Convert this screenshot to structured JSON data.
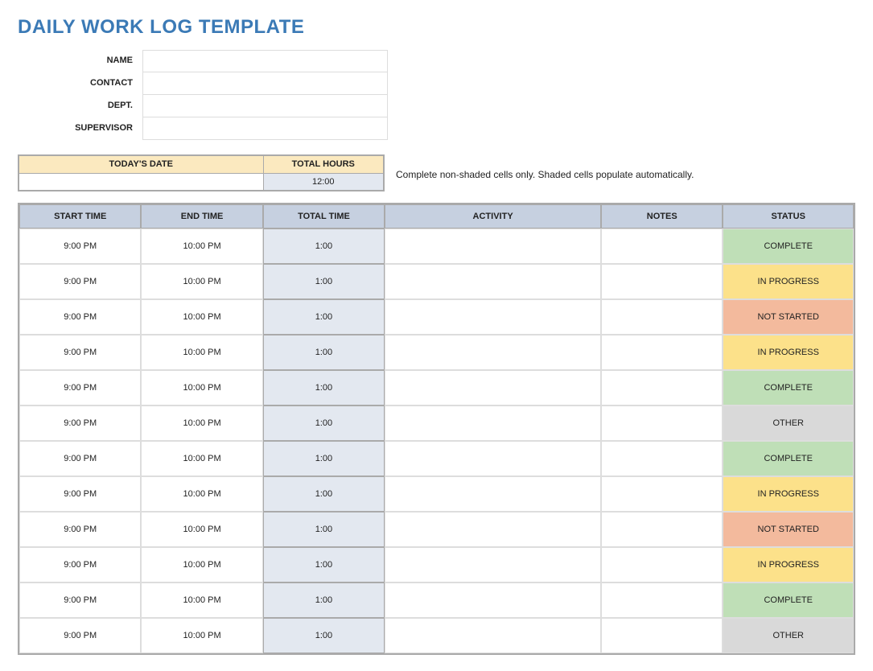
{
  "title": "DAILY WORK LOG TEMPLATE",
  "info": {
    "name_label": "NAME",
    "contact_label": "CONTACT",
    "dept_label": "DEPT.",
    "supervisor_label": "SUPERVISOR",
    "name_value": "",
    "contact_value": "",
    "dept_value": "",
    "supervisor_value": ""
  },
  "summary": {
    "date_label": "TODAY'S DATE",
    "hours_label": "TOTAL HOURS",
    "date_value": "",
    "hours_value": "12:00"
  },
  "instruction": "Complete non-shaded cells only. Shaded cells populate automatically.",
  "columns": {
    "start": "START TIME",
    "end": "END TIME",
    "total": "TOTAL TIME",
    "activity": "ACTIVITY",
    "notes": "NOTES",
    "status": "STATUS"
  },
  "status_colors": {
    "COMPLETE": "status-complete",
    "IN PROGRESS": "status-in-progress",
    "NOT STARTED": "status-not-started",
    "OTHER": "status-other"
  },
  "rows": [
    {
      "start": "9:00 PM",
      "end": "10:00 PM",
      "total": "1:00",
      "activity": "",
      "notes": "",
      "status": "COMPLETE"
    },
    {
      "start": "9:00 PM",
      "end": "10:00 PM",
      "total": "1:00",
      "activity": "",
      "notes": "",
      "status": "IN PROGRESS"
    },
    {
      "start": "9:00 PM",
      "end": "10:00 PM",
      "total": "1:00",
      "activity": "",
      "notes": "",
      "status": "NOT STARTED"
    },
    {
      "start": "9:00 PM",
      "end": "10:00 PM",
      "total": "1:00",
      "activity": "",
      "notes": "",
      "status": "IN PROGRESS"
    },
    {
      "start": "9:00 PM",
      "end": "10:00 PM",
      "total": "1:00",
      "activity": "",
      "notes": "",
      "status": "COMPLETE"
    },
    {
      "start": "9:00 PM",
      "end": "10:00 PM",
      "total": "1:00",
      "activity": "",
      "notes": "",
      "status": "OTHER"
    },
    {
      "start": "9:00 PM",
      "end": "10:00 PM",
      "total": "1:00",
      "activity": "",
      "notes": "",
      "status": "COMPLETE"
    },
    {
      "start": "9:00 PM",
      "end": "10:00 PM",
      "total": "1:00",
      "activity": "",
      "notes": "",
      "status": "IN PROGRESS"
    },
    {
      "start": "9:00 PM",
      "end": "10:00 PM",
      "total": "1:00",
      "activity": "",
      "notes": "",
      "status": "NOT STARTED"
    },
    {
      "start": "9:00 PM",
      "end": "10:00 PM",
      "total": "1:00",
      "activity": "",
      "notes": "",
      "status": "IN PROGRESS"
    },
    {
      "start": "9:00 PM",
      "end": "10:00 PM",
      "total": "1:00",
      "activity": "",
      "notes": "",
      "status": "COMPLETE"
    },
    {
      "start": "9:00 PM",
      "end": "10:00 PM",
      "total": "1:00",
      "activity": "",
      "notes": "",
      "status": "OTHER"
    }
  ]
}
